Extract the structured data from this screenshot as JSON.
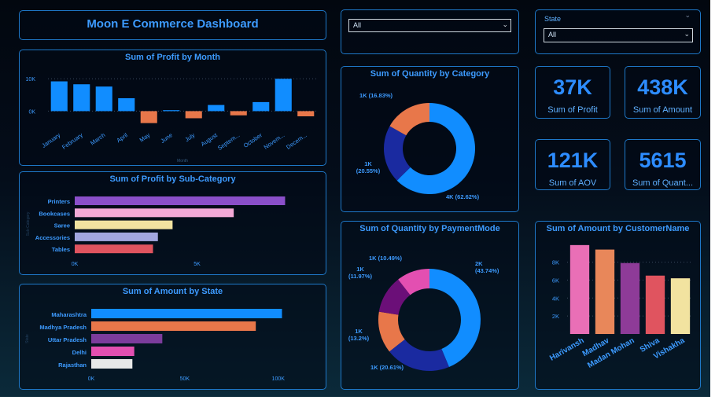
{
  "title": "Moon E Commerce Dashboard",
  "filters": {
    "category_value": "All",
    "state_label": "State",
    "state_value": "All"
  },
  "cards": [
    {
      "value": "37K",
      "label": "Sum of Profit"
    },
    {
      "value": "438K",
      "label": "Sum of Amount"
    },
    {
      "value": "121K",
      "label": "Sum of AOV"
    },
    {
      "value": "5615",
      "label": "Sum of Quant..."
    }
  ],
  "colors": {
    "accent": "#3d9bff",
    "border": "#1e78c8",
    "positive": "#118dff",
    "negative": "#e8774a"
  },
  "chart_data": [
    {
      "id": "profit_by_month",
      "type": "bar",
      "title": "Sum of Profit by Month",
      "xlabel": "Month",
      "categories": [
        "January",
        "February",
        "March",
        "April",
        "May",
        "June",
        "July",
        "August",
        "Septem...",
        "October",
        "Novem...",
        "Decem..."
      ],
      "values": [
        9200,
        8300,
        7600,
        4000,
        -3700,
        300,
        -2200,
        1900,
        -1300,
        2800,
        10000,
        -1600
      ],
      "ylim": [
        -5000,
        12000
      ],
      "yticks": [
        "10K",
        "0K"
      ]
    },
    {
      "id": "profit_by_subcategory",
      "type": "bar",
      "orientation": "horizontal",
      "title": "Sum of Profit by Sub-Category",
      "ylabel": "Sub-Category",
      "categories": [
        "Printers",
        "Bookcases",
        "Saree",
        "Accessories",
        "Tables"
      ],
      "values": [
        8600,
        6500,
        4000,
        3400,
        3200
      ],
      "colors": [
        "#8a4fc9",
        "#f3a9d6",
        "#f2e3a0",
        "#a2a7e0",
        "#e0545f"
      ],
      "xticks": [
        "0K",
        "5K"
      ],
      "xlim": [
        0,
        10000
      ]
    },
    {
      "id": "amount_by_state",
      "type": "bar",
      "orientation": "horizontal",
      "title": "Sum of Amount by State",
      "ylabel": "State",
      "categories": [
        "Maharashtra",
        "Madhya Pradesh",
        "Uttar Pradesh",
        "Delhi",
        "Rajasthan"
      ],
      "values": [
        102000,
        88000,
        38000,
        23000,
        22000
      ],
      "colors": [
        "#118dff",
        "#e8774a",
        "#7c3c9c",
        "#e34fb1",
        "#e8e8e8"
      ],
      "xticks": [
        "0K",
        "50K",
        "100K"
      ],
      "xlim": [
        0,
        106000
      ]
    },
    {
      "id": "quantity_by_category",
      "type": "pie",
      "donut": true,
      "title": "Sum of Quantity by Category",
      "slices": [
        {
          "value": 62.62,
          "label": "4K (62.62%)",
          "color": "#118dff"
        },
        {
          "value": 20.55,
          "label": "1K\n(20.55%)",
          "color": "#1a2aa0"
        },
        {
          "value": 16.83,
          "label": "1K (16.83%)",
          "color": "#e8774a"
        }
      ]
    },
    {
      "id": "quantity_by_paymentmode",
      "type": "pie",
      "donut": true,
      "title": "Sum of Quantity by PaymentMode",
      "slices": [
        {
          "value": 43.74,
          "label": "2K\n(43.74%)",
          "color": "#118dff"
        },
        {
          "value": 20.61,
          "label": "1K (20.61%)",
          "color": "#1a2aa0"
        },
        {
          "value": 13.2,
          "label": "1K\n(13.2%)",
          "color": "#e8774a"
        },
        {
          "value": 11.97,
          "label": "1K\n(11.97%)",
          "color": "#6b0f78"
        },
        {
          "value": 10.49,
          "label": "1K (10.49%)",
          "color": "#e34fb1"
        }
      ]
    },
    {
      "id": "amount_by_customer",
      "type": "bar",
      "title": "Sum of Amount by CustomerName",
      "categories": [
        "Harivansh",
        "Madhav",
        "Madan Mohan",
        "Shiva",
        "Vishakha"
      ],
      "values": [
        9900,
        9400,
        7900,
        6500,
        6200
      ],
      "colors": [
        "#e96fb6",
        "#e8875a",
        "#8e3b98",
        "#e0545f",
        "#f2e3a0"
      ],
      "ylim": [
        0,
        10500
      ],
      "yticks": [
        "8K",
        "6K",
        "4K",
        "2K"
      ]
    }
  ]
}
